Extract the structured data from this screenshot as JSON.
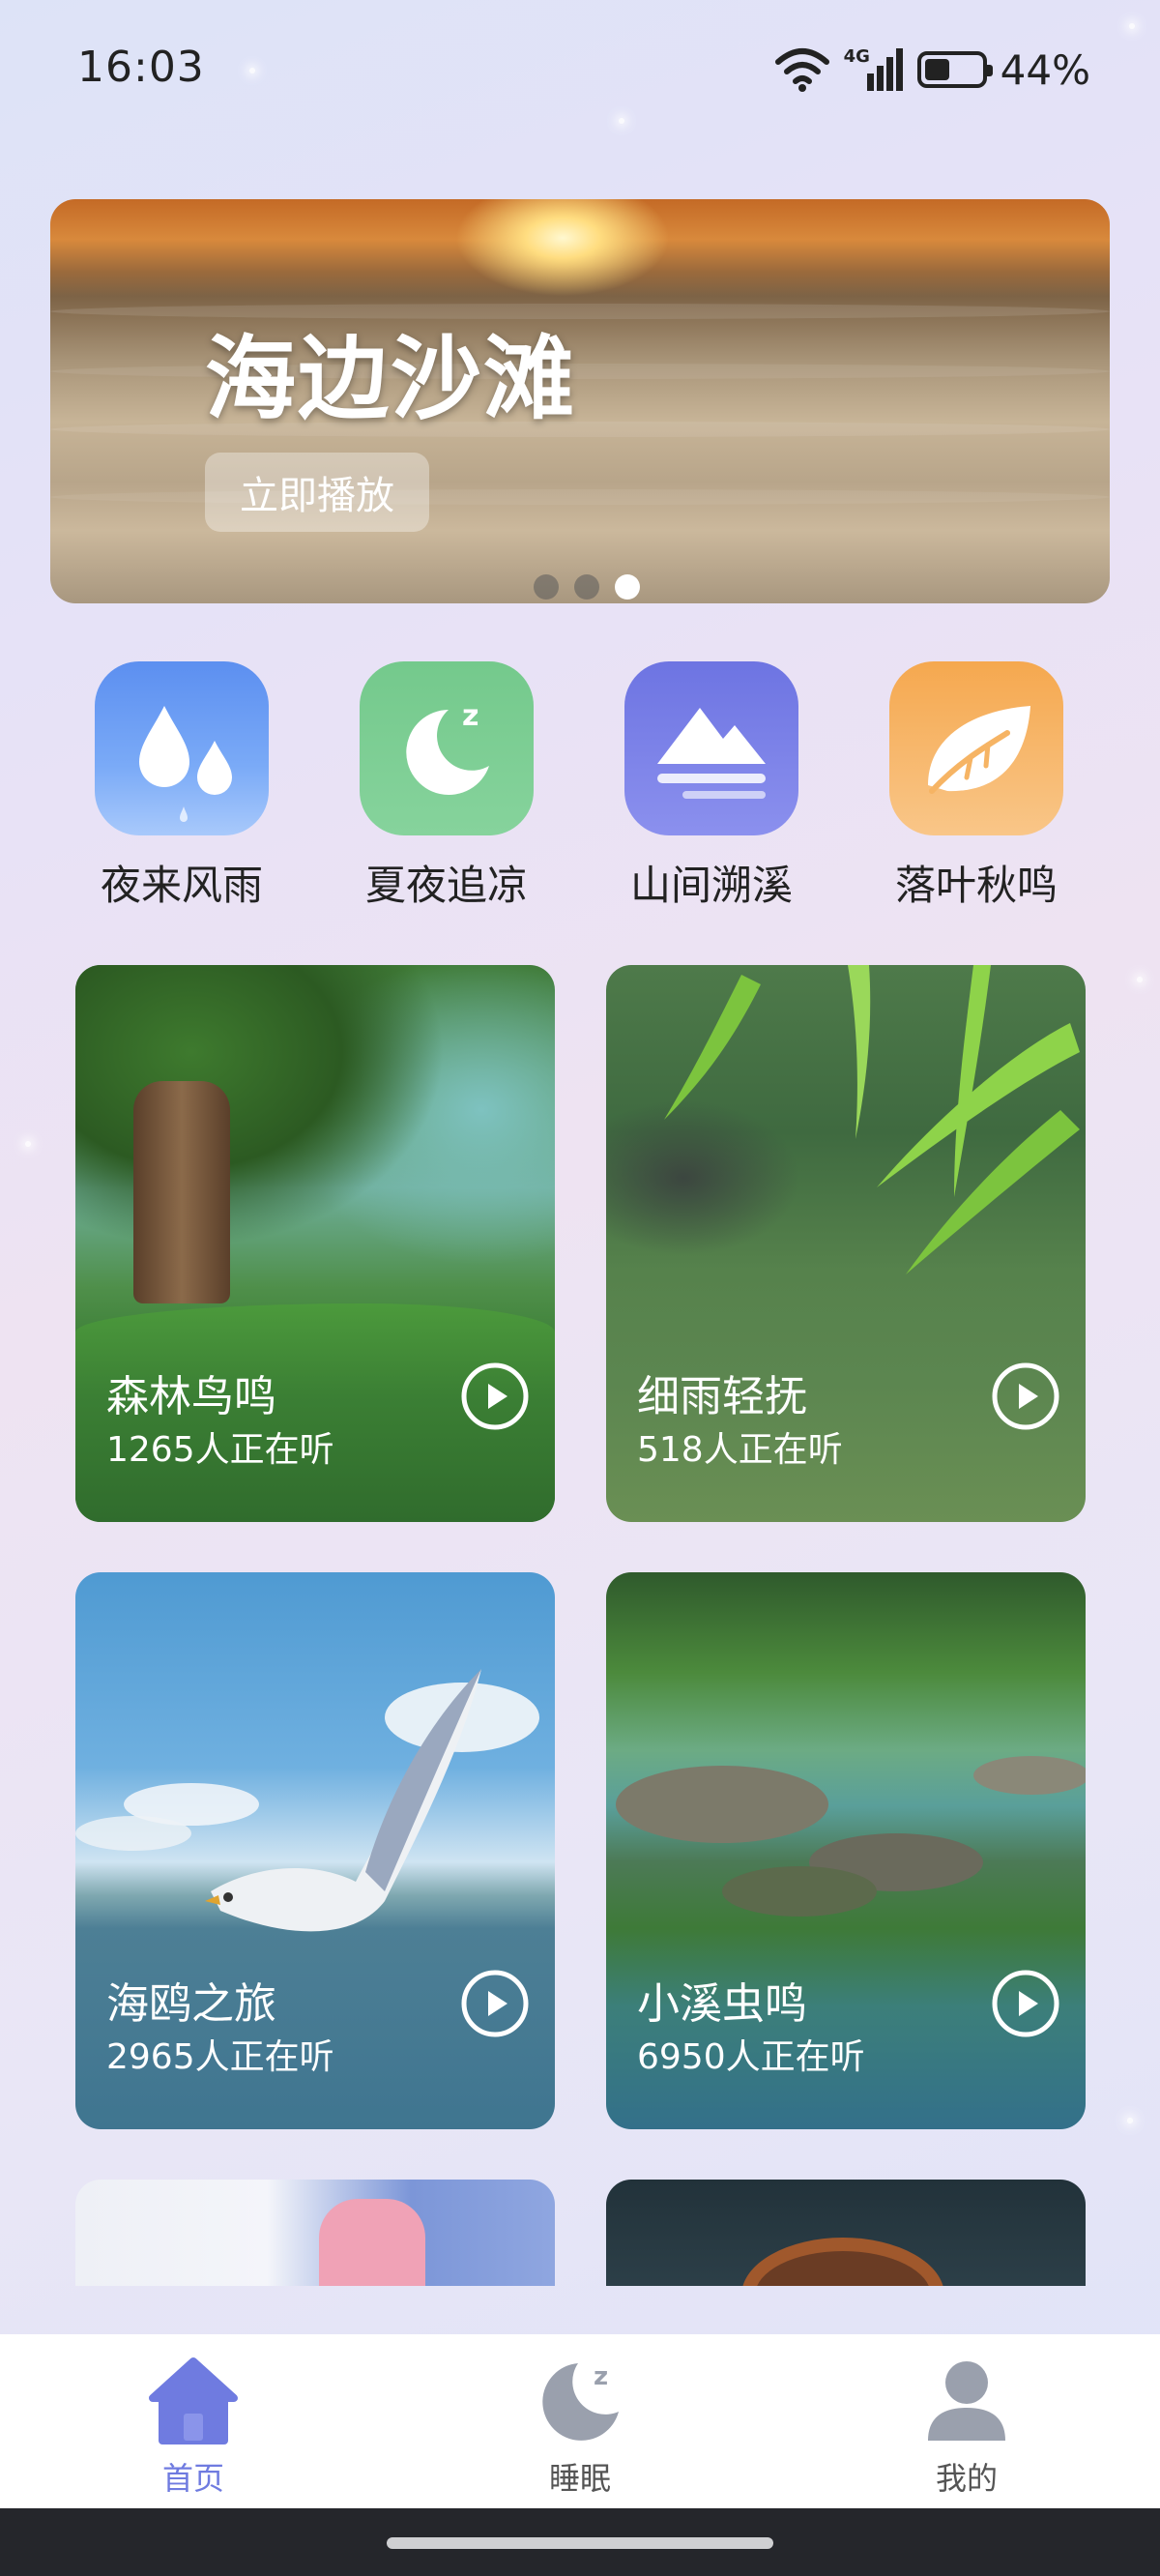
{
  "status_bar": {
    "time": "16:03",
    "network": "4G",
    "battery_text": "44%",
    "battery_level": 0.44
  },
  "banner": {
    "title": "海边沙滩",
    "play_label": "立即播放",
    "page_count": 3,
    "active_page": 3
  },
  "categories": [
    {
      "label": "夜来风雨",
      "icon": "raindrops-icon",
      "color": "#6a9cf3"
    },
    {
      "label": "夏夜追凉",
      "icon": "moon-sleep-icon",
      "color": "#7dcf94"
    },
    {
      "label": "山间溯溪",
      "icon": "mountain-icon",
      "color": "#7a80e8"
    },
    {
      "label": "落叶秋鸣",
      "icon": "leaf-icon",
      "color": "#f6b464"
    }
  ],
  "cards": [
    {
      "title": "森林鸟鸣",
      "count": "1265人正在听"
    },
    {
      "title": "细雨轻抚",
      "count": "518人正在听"
    },
    {
      "title": "海鸥之旅",
      "count": "2965人正在听"
    },
    {
      "title": "小溪虫鸣",
      "count": "6950人正在听"
    }
  ],
  "tabbar": {
    "items": [
      {
        "label": "首页",
        "icon": "home-icon",
        "active": true
      },
      {
        "label": "睡眠",
        "icon": "moon-sleep-icon",
        "active": false
      },
      {
        "label": "我的",
        "icon": "user-icon",
        "active": false
      }
    ],
    "active_color": "#6f7be0",
    "inactive_color": "#9aa0ad"
  }
}
